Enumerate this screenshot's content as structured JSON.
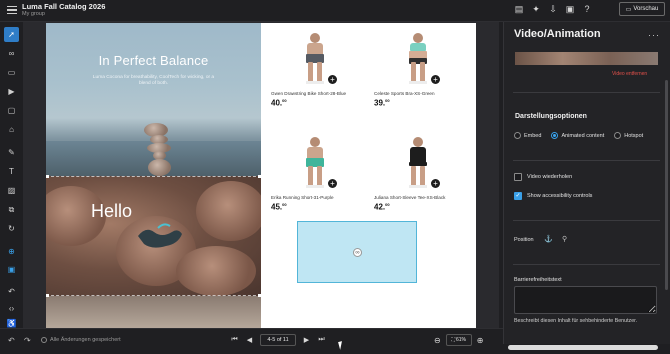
{
  "header": {
    "title": "Luma Fall Catalog 2026",
    "subtitle": "My group",
    "preview_label": "Vorschau",
    "icons": [
      "document-icon",
      "magic-wand-icon",
      "download-icon",
      "layout-icon",
      "help-icon"
    ]
  },
  "left_tools": [
    "select-icon",
    "link-icon",
    "page-icon",
    "video-icon",
    "frame-icon",
    "tag-icon",
    "paint-icon",
    "text-icon",
    "image-icon",
    "layers-icon",
    "refresh-icon",
    "add-icon",
    "info-icon",
    "undo-icon",
    "code-icon",
    "accessibility-icon"
  ],
  "canvas": {
    "balance_title": "In Perfect Balance",
    "balance_desc": "Luma Cocona for breathability, CoolTech for wicking, or a blend of both.",
    "hello_text": "Hello",
    "products": [
      {
        "name": "Gwen Drawstring Bike Short-28-Blue",
        "price": "40.",
        "cents": "00",
        "shorts_color": "#555a62"
      },
      {
        "name": "Celeste Sports Bra-XS-Green",
        "price": "39.",
        "cents": "00",
        "shorts_color": "#7ad0c0"
      },
      {
        "name": "Erika Running Short-31-Purple",
        "price": "45.",
        "cents": "00",
        "shorts_color": "#3fb59b"
      },
      {
        "name": "Juliana Short-Sleeve Tee-XS-Black",
        "price": "42.",
        "cents": "00",
        "shorts_color": "#1d1d1d"
      }
    ]
  },
  "footer": {
    "saved_text": "Alle Änderungen gespeichert",
    "page_indicator": "4-5 of 11",
    "zoom_level": "61%"
  },
  "panel": {
    "title": "Video/Animation",
    "remove_label": "Video entfernen",
    "display_options_title": "Darstellungsoptionen",
    "options": {
      "embed": "Embed",
      "animated": "Animated content",
      "hotspot": "Hotspot"
    },
    "repeat_label": "Video wiederholen",
    "accessibility_controls_label": "Show accessibility controls",
    "position_label": "Position",
    "alt_label": "Barrierefreiheitstext",
    "alt_help": "Beschreibt diesen Inhalt für sehbehinderte Benutzer."
  },
  "colors": {
    "accent": "#3aa0e8",
    "danger": "#e2504a",
    "panel_bg": "#232326",
    "selected_box": "#bfe6f3"
  }
}
